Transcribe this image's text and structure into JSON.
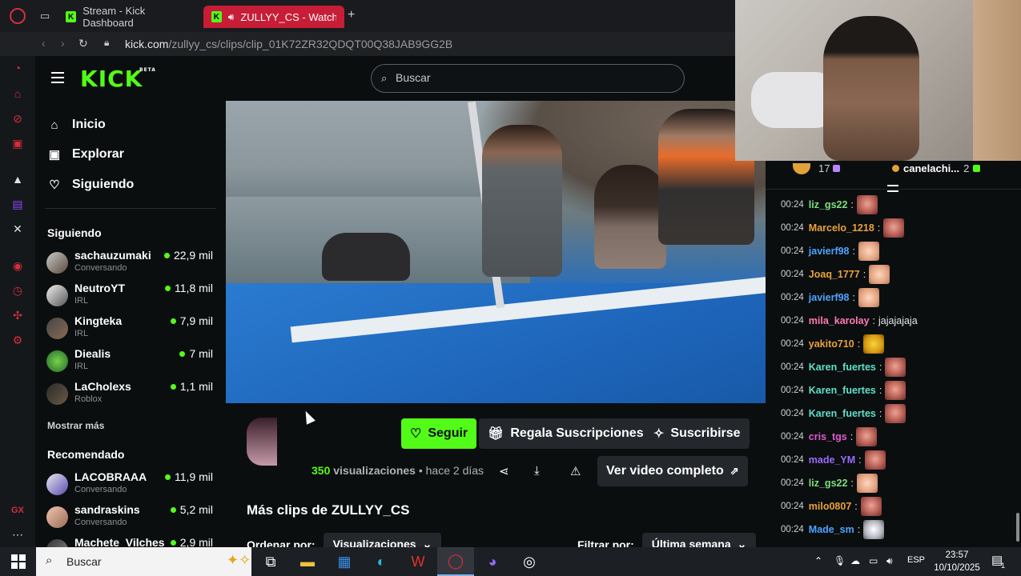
{
  "browser": {
    "tabs": [
      {
        "label": "Stream - Kick Dashboard",
        "active": false
      },
      {
        "label": "ZULLYY_CS - Watch c",
        "active": true
      }
    ],
    "url_host": "kick.com",
    "url_path": "/zullyy_cs/clips/clip_01K72ZR32QDQT00Q38JAB9GG2B"
  },
  "kick": {
    "logo_text": "KICK",
    "logo_badge": "BETA",
    "search_placeholder": "Buscar",
    "accent": "#53fc18",
    "nav": [
      {
        "label": "Inicio",
        "icon": "home-icon"
      },
      {
        "label": "Explorar",
        "icon": "compass-icon"
      },
      {
        "label": "Siguiendo",
        "icon": "heart-icon"
      }
    ],
    "following_title": "Siguiendo",
    "following": [
      {
        "name": "sachauzumaki",
        "category": "Conversando",
        "viewers": "22,9 mil"
      },
      {
        "name": "NeutroYT",
        "category": "IRL",
        "viewers": "11,8 mil"
      },
      {
        "name": "Kingteka",
        "category": "IRL",
        "viewers": "7,9 mil"
      },
      {
        "name": "Diealis",
        "category": "IRL",
        "viewers": "7 mil"
      },
      {
        "name": "LaCholexs",
        "category": "Roblox",
        "viewers": "1,1 mil"
      }
    ],
    "show_more": "Mostrar más",
    "recommended_title": "Recomendado",
    "recommended": [
      {
        "name": "LACOBRAAA",
        "category": "Conversando",
        "viewers": "11,9 mil"
      },
      {
        "name": "sandraskins",
        "category": "Conversando",
        "viewers": "5,2 mil"
      },
      {
        "name": "Machete_Vilches",
        "category": "",
        "viewers": "2,9 mil"
      }
    ]
  },
  "clip": {
    "follow": "Seguir",
    "gift": "Regala Suscripciones",
    "subscribe": "Suscribirse",
    "views_count": "350",
    "views_label": "visualizaciones",
    "time_ago": "• hace 2 días",
    "full_video": "Ver video completo",
    "more_clips_title": "Más clips de ZULLYY_CS",
    "sort_label": "Ordenar por:",
    "sort_value": "Visualizaciones",
    "filter_label": "Filtrar por:",
    "filter_value": "Última semana"
  },
  "chat": {
    "pinned_count": "17",
    "pinned_user": "canelachi...",
    "pinned_user_count": "2",
    "messages": [
      {
        "time": "00:24",
        "user": "liz_gs22",
        "color": "#7ee07e",
        "text": "",
        "emote": "e"
      },
      {
        "time": "00:24",
        "user": "Marcelo_1218",
        "color": "#e9a23b",
        "text": "",
        "emote": "e"
      },
      {
        "time": "00:24",
        "user": "javierf98",
        "color": "#4fa3ff",
        "text": "",
        "emote": "s"
      },
      {
        "time": "00:24",
        "user": "Joaq_1777",
        "color": "#e9a23b",
        "text": "",
        "emote": "s"
      },
      {
        "time": "00:24",
        "user": "javierf98",
        "color": "#4fa3ff",
        "text": "",
        "emote": "s"
      },
      {
        "time": "00:24",
        "user": "mila_karolay",
        "color": "#ff7ab6",
        "text": "jajajajaja",
        "emote": ""
      },
      {
        "time": "00:24",
        "user": "yakito710",
        "color": "#e9a23b",
        "text": "",
        "emote": "y"
      },
      {
        "time": "00:24",
        "user": "Karen_fuertes",
        "color": "#5fe0c8",
        "text": "",
        "emote": "e"
      },
      {
        "time": "00:24",
        "user": "Karen_fuertes",
        "color": "#5fe0c8",
        "text": "",
        "emote": "e"
      },
      {
        "time": "00:24",
        "user": "Karen_fuertes",
        "color": "#5fe0c8",
        "text": "",
        "emote": "e"
      },
      {
        "time": "00:24",
        "user": "cris_tgs",
        "color": "#e05ad0",
        "text": "",
        "emote": "e"
      },
      {
        "time": "00:24",
        "user": "made_YM",
        "color": "#9b6bff",
        "text": "",
        "emote": "e"
      },
      {
        "time": "00:24",
        "user": "liz_gs22",
        "color": "#7ee07e",
        "text": "",
        "emote": "s"
      },
      {
        "time": "00:24",
        "user": "milo0807",
        "color": "#e9a23b",
        "text": "",
        "emote": "e"
      },
      {
        "time": "00:24",
        "user": "Made_sm",
        "color": "#4fa3ff",
        "text": "",
        "emote": "w"
      }
    ]
  },
  "taskbar": {
    "search_label": "Buscar",
    "lang": "ESP",
    "time": "23:57",
    "date": "10/10/2025",
    "notifications": "1"
  }
}
